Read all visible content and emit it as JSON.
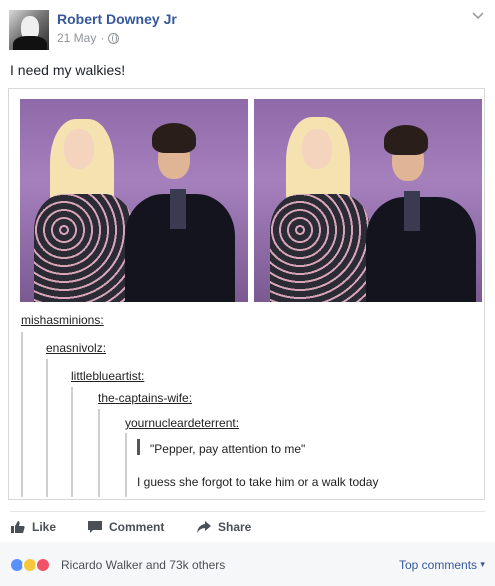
{
  "post": {
    "author": "Robert Downey Jr",
    "date": "21 May",
    "meta_separator": "·",
    "text": "I need my walkies!",
    "image": {
      "thread": {
        "user1": "mishasminions:",
        "user2": "enasnivolz:",
        "user3": "littleblueartist:",
        "user4": "the-captains-wife:",
        "user5": "yournucleardeterrent:",
        "quote": "\"Pepper, pay attention to me\"",
        "reply": "I guess she forgot to take him or a walk today"
      }
    }
  },
  "actions": {
    "like": "Like",
    "comment": "Comment",
    "share": "Share"
  },
  "footer": {
    "likers": "Ricardo Walker and 73k others",
    "top_comments": "Top comments",
    "top_comments_caret": "▾"
  },
  "colors": {
    "link_blue": "#365899",
    "meta_gray": "#90949c",
    "action_gray": "#4b4f56",
    "like_blue": "#5890ff",
    "haha_yellow": "#f7c83b",
    "love_red": "#f25268"
  },
  "icons": {
    "avatar": "avatar",
    "globe": "globe-icon",
    "chevron": "chevron-down-icon",
    "like": "thumbs-up-icon",
    "comment": "speech-bubble-icon",
    "share": "share-arrow-icon"
  }
}
